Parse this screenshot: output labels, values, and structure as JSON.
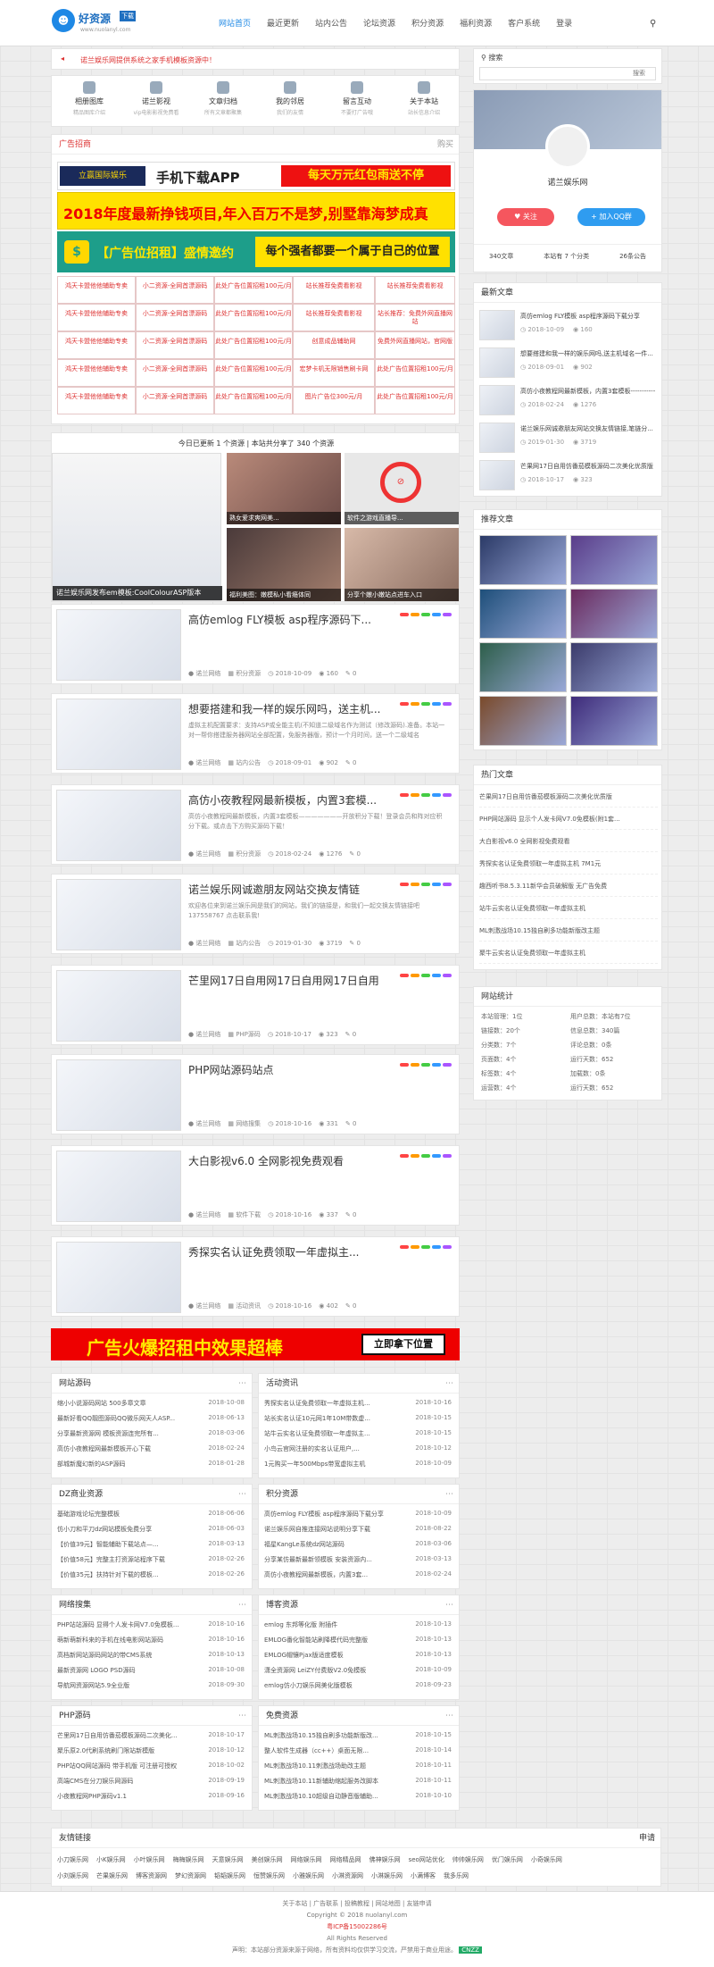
{
  "header": {
    "logo_text": "好资源",
    "logo_badge": "下载",
    "logo_url": "www.nuolanyl.com",
    "nav": [
      "网站首页",
      "最近更新",
      "站内公告",
      "论坛资源",
      "积分资源",
      "福利资源",
      "客户系统",
      "登录"
    ]
  },
  "notice": "诺兰娱乐网提供系统之家手机模板资源中！",
  "quicklinks": [
    {
      "t": "相册图库",
      "s": "精品图库介绍"
    },
    {
      "t": "诺兰影视",
      "s": "vip电影影视免费看"
    },
    {
      "t": "文章归档",
      "s": "所有文章都聚集"
    },
    {
      "t": "我的邻居",
      "s": "我们的友情"
    },
    {
      "t": "留言互动",
      "s": "不要打广告哦"
    },
    {
      "t": "关于本站",
      "s": "站长信息介绍"
    }
  ],
  "ad_section": {
    "title": "广告招商",
    "more": "购买",
    "banner1": "手机下载APP",
    "banner1b": "每天万元红包雨送不停",
    "banner2": "2018年度最新挣钱项目,年入百万不是梦,别墅靠海梦成真",
    "banner3a": "【广告位招租】盛情邀约",
    "banner3b": "每个强者都要一个属于自己的位置",
    "brand": "立赢国际娱乐"
  },
  "ad_table": [
    [
      "鸿天卡盟他他辅助专卖",
      "小二资源-全网首漂源码",
      "此处广告位置招租100元/月",
      "站长推荐免费看影视",
      "站长推荐免费看影视"
    ],
    [
      "鸿天卡盟他他辅助专卖",
      "小二资源-全网首漂源码",
      "此处广告位置招租100元/月",
      "站长推荐免费看影视",
      "站长推荐：免费外网直播网站"
    ],
    [
      "鸿天卡盟他他辅助专卖",
      "小二资源-全网首漂源码",
      "此处广告位置招租100元/月",
      "创意成品辅助网",
      "免费外网直播网站，官网版"
    ],
    [
      "鸿天卡盟他他辅助专卖",
      "小二资源-全网首漂源码",
      "此处广告位置招租100元/月",
      "宏梦卡机无限销售刷卡网",
      "此处广告位置招租100元/月"
    ],
    [
      "鸿天卡盟他他辅助专卖",
      "小二资源-全网首漂源码",
      "此处广告位置招租100元/月",
      "图片广告位300元/月",
      "此处广告位置招租100元/月"
    ]
  ],
  "stats_line": "今日已更新 1 个资源 | 本站共分享了 340 个资源",
  "slider": {
    "caption": "诺兰娱乐网发布em模板:CoolColourASP版本",
    "c1": "熟女爱求爽网美...",
    "c2": "软件之游戏直播导...",
    "c3": "福利美图：嫩模私小看瘾体同",
    "c4": "分享个嫩小嫩站点进车入口"
  },
  "posts": [
    {
      "title": "高仿emlog FLY模板 asp程序源码下...",
      "excerpt": "",
      "date": "2018-10-09",
      "views": "160",
      "comments": "0",
      "cat": "积分资源"
    },
    {
      "title": "想要搭建和我一样的娱乐网吗，送主机...",
      "excerpt": "虚拟主机配置要求：支持ASP或全能主机(不知道二级域名作为测试（修改源码).准备。本站一对一帮你搭建服务器网站全部配置，免服务器版，预计一个月时间，送一个二级域名",
      "date": "2018-09-01",
      "views": "902",
      "comments": "0",
      "cat": "站内公告"
    },
    {
      "title": "高仿小夜教程网最新模板，内置3套模...",
      "excerpt": "高仿小夜教程网最新模板，内置3套模板———————开放积分下载！登录会员和阵对应积分下载。或点击下方购买源码下载！",
      "date": "2018-02-24",
      "views": "1276",
      "comments": "0",
      "cat": "积分资源"
    },
    {
      "title": "诺兰娱乐网诚邀朋友网站交换友情链",
      "excerpt": "欢迎各位来到诺兰娱乐网是我们的网站，我们的链接是，和我们一起交换友情链接吧 137558767 点击联系我!",
      "date": "2019-01-30",
      "views": "3719",
      "comments": "0",
      "cat": "站内公告"
    },
    {
      "title": "芒里网17日自用网17日自用网17日自用",
      "excerpt": "",
      "date": "2018-10-17",
      "views": "323",
      "comments": "0",
      "cat": "PHP源码"
    },
    {
      "title": "PHP网站源码站点",
      "excerpt": "",
      "date": "2018-10-16",
      "views": "331",
      "comments": "0",
      "cat": "网络搜集"
    },
    {
      "title": "大白影视v6.0 全网影视免费观看",
      "excerpt": "",
      "date": "2018-10-16",
      "views": "337",
      "comments": "0",
      "cat": "软件下载"
    },
    {
      "title": "秀探实名认证免费领取一年虚拟主...",
      "excerpt": "",
      "date": "2018-10-16",
      "views": "402",
      "comments": "0",
      "cat": "活动资讯"
    }
  ],
  "author": "诺兰网络",
  "bottom_banner": {
    "text": "广告火爆招租中效果超棒",
    "btn": "立即拿下位置"
  },
  "cat_boxes": [
    {
      "title": "网站源码",
      "items": [
        [
          "缩小小说源码网站 500多章文章",
          "2018-10-08"
        ],
        [
          "最新好看QQ靓图源码QQ微乐网天人ASP...",
          "2018-06-13"
        ],
        [
          "分享最新资源网 模板资源连完所有...",
          "2018-03-06"
        ],
        [
          "高仿小夜教程网最新模板开心下载",
          "2018-02-24"
        ],
        [
          "部城新魔幻新的ASP源码",
          "2018-01-28"
        ]
      ]
    },
    {
      "title": "活动资讯",
      "items": [
        [
          "秀探实名认证免费领取一年虚拟主机...",
          "2018-10-16"
        ],
        [
          "站长实名认证10元网1年10M带数虚...",
          "2018-10-15"
        ],
        [
          "站牛云实名认证免费领取一年虚拟主...",
          "2018-10-15"
        ],
        [
          "小鸟云官网注册的实名认证用户,...",
          "2018-10-12"
        ],
        [
          "1元购买一年500Mbps带宽虚拟主机",
          "2018-10-09"
        ]
      ]
    },
    {
      "title": "DZ商业资源",
      "items": [
        [
          "基础游戏论坛完整模板",
          "2018-06-06"
        ],
        [
          "仿小刀和平刀dz网站模板免费分享",
          "2018-06-03"
        ],
        [
          "【价值39元】智能辅助下载站点—...",
          "2018-03-13"
        ],
        [
          "【价值58元】完整主打资源站程序下载",
          "2018-02-26"
        ],
        [
          "【价值35元】扶持针对下载的模板...",
          "2018-02-26"
        ]
      ]
    },
    {
      "title": "积分资源",
      "items": [
        [
          "高仿emlog FLY模板 asp程序源码下载分享",
          "2018-10-09"
        ],
        [
          "诺兰娱乐网自推连接网站说明分享下载",
          "2018-08-22"
        ],
        [
          "福星KangLe系统dz网站源码",
          "2018-03-06"
        ],
        [
          "分享某仿最新最新领模板 安装资源内...",
          "2018-03-13"
        ],
        [
          "高仿小夜教程网最新模板，内置3套...",
          "2018-02-24"
        ]
      ]
    },
    {
      "title": "网络搜集",
      "items": [
        [
          "PHP站站源码 显得个人发卡网V7.0免模板...",
          "2018-10-16"
        ],
        [
          "萌新萌新科来的手机在线电影网站源码",
          "2018-10-16"
        ],
        [
          "高档新网站源码网站的带CMS系统",
          "2018-10-13"
        ],
        [
          "最新资源网 LOGO PSD源码",
          "2018-10-08"
        ],
        [
          "导航网资源网站5.9全业版",
          "2018-09-30"
        ]
      ]
    },
    {
      "title": "博客资源",
      "items": [
        [
          "emlog 东邦等化版 附插件",
          "2018-10-13"
        ],
        [
          "EMLOG番化智能站刷降模代码完整版",
          "2018-10-13"
        ],
        [
          "EMLOG帽镶Pjax版适度模板",
          "2018-10-13"
        ],
        [
          "潇全资源网 LeiZY付费版V2.0免模板",
          "2018-10-09"
        ],
        [
          "emlog仿小刀娱乐网美化版模板",
          "2018-09-23"
        ]
      ]
    },
    {
      "title": "PHP源码",
      "items": [
        [
          "芒里网17日自用仿番茄模板源码二次美化...",
          "2018-10-17"
        ],
        [
          "聚乐原2.0代刷系统刷门限站新模版",
          "2018-10-12"
        ],
        [
          "PHP站QQ网站源码 带手机版 可注册可授权",
          "2018-10-02"
        ],
        [
          "高端CMS在分刀娱乐网源码",
          "2018-09-19"
        ],
        [
          "小夜教程网PHP源码v1.1",
          "2018-09-16"
        ]
      ]
    },
    {
      "title": "免费资源",
      "items": [
        [
          "ML刺激战场10.15独自刷多功能新版改...",
          "2018-10-15"
        ],
        [
          "整人软件生成器（cc++）桌面无限...",
          "2018-10-14"
        ],
        [
          "ML刺激战场10.11刺激战场助改主题",
          "2018-10-11"
        ],
        [
          "ML刺激战场10.11新辅助缩起服务改脚本",
          "2018-10-11"
        ],
        [
          "ML刺激战场10.10超级自动静音版辅助...",
          "2018-10-10"
        ]
      ]
    }
  ],
  "friend_links": {
    "title": "友情链接",
    "apply": "申请",
    "row1": [
      "小刀娱乐网",
      "小K娱乐网",
      "小叶娱乐网",
      "梅梅娱乐网",
      "天意娱乐网",
      "美创娱乐网",
      "网络娱乐网",
      "网络精品网",
      "佛神娱乐网",
      "seo网站优化",
      "帅帅娱乐网",
      "优门娱乐网",
      "小奇娱乐网"
    ],
    "row2": [
      "小刘娱乐网",
      "芒果娱乐网",
      "博客资源网",
      "梦幻资源网",
      "韬韬娱乐网",
      "恒赞娱乐网",
      "小雅娱乐网",
      "小淋资源网",
      "小淋娱乐网",
      "小满博客",
      "我多乐网"
    ]
  },
  "footer": {
    "links": "关于本站 | 广告联系 | 投稿教程 | 网站地图 | 友链申请",
    "copy": "Copyright © 2018 nuolanyl.com",
    "icp": "粤ICP备15002286号",
    "rights": "All Rights Reserved",
    "disclaimer": "声明：本站部分资源来源于网络，所有资料均仅供学习交流，严禁用于商业用途。",
    "cnzz": "CNZZ"
  },
  "sidebar": {
    "search_title": "搜索",
    "search_btn": "搜索",
    "profile_name": "诺兰娱乐网",
    "follow": "关注",
    "add_qq": "加入QQ群",
    "stats": [
      "340文章",
      "本站有 7 个分类",
      "26条公告"
    ],
    "latest_title": "最新文章",
    "latest": [
      {
        "t": "高仿emlog FLY模板 asp程序源码下载分享",
        "d": "2018-10-09",
        "v": "160"
      },
      {
        "t": "想要搭建和我一样的娱乐网吗,送主机域名一件...",
        "d": "2018-09-01",
        "v": "902"
      },
      {
        "t": "高仿小夜教程网最新模板，内置3套模板-----------",
        "d": "2018-02-24",
        "v": "1276"
      },
      {
        "t": "诺兰娱乐网诚邀朋友网站交换友情链接,笔链分...",
        "d": "2019-01-30",
        "v": "3719"
      },
      {
        "t": "芒果网17日自用仿番茄模板源码二次美化优质版",
        "d": "2018-10-17",
        "v": "323"
      }
    ],
    "recommend_title": "推荐文章",
    "hot_title": "热门文章",
    "hot": [
      "芒果网17日自用仿番茄模板源码二次美化优质版",
      "PHP网站源码 显示个人发卡网V7.0免模板(附1套...",
      "大白影视v6.0 全网影视免费观看",
      "秀探实名认证免费领取一年虚拟主机 7M1元",
      "趣西听书8.5.3.11新华会员破解版 无广告免费",
      "站牛云实名认证免费领取一年虚拟主机",
      "ML刺激战场10.15独自刷多功能新版改主题",
      "聚牛云实名认证免费领取一年虚拟主机"
    ],
    "site_stats_title": "网站统计",
    "site_stats": [
      [
        "本站管理：1位",
        "用户总数：本站有7位"
      ],
      [
        "链接数：20个",
        "信息总数：340篇"
      ],
      [
        "分类数：7个",
        "评论总数：0条"
      ],
      [
        "页面数：4个",
        "运行天数：652"
      ],
      [
        "标签数：4个",
        "加载数：0条"
      ],
      [
        "运营数：4个",
        "运行天数：652"
      ]
    ]
  },
  "colors": {
    "accent": "#1e88e5",
    "red": "#e02020",
    "yellow": "#ffea00"
  }
}
